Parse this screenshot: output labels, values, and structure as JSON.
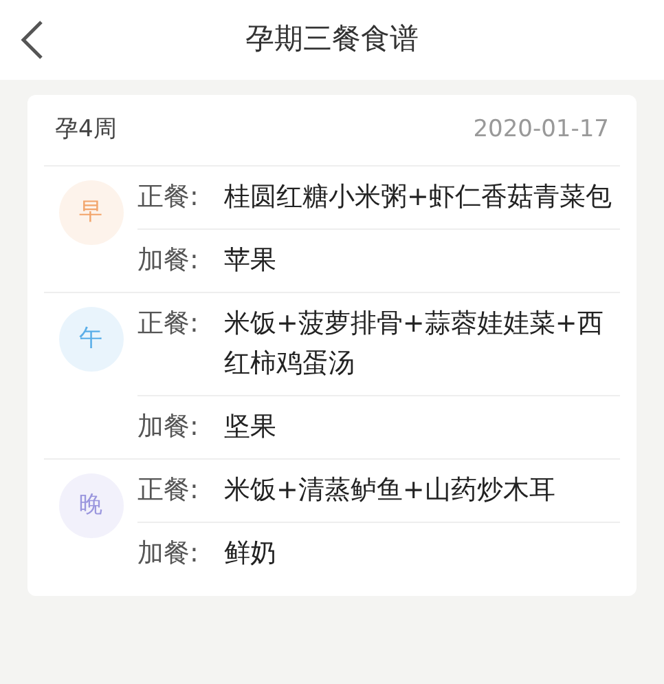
{
  "header": {
    "title": "孕期三餐食谱"
  },
  "card": {
    "week": "孕4周",
    "date": "2020-01-17",
    "meals": [
      {
        "badge": "早",
        "color": "#f2a56c",
        "items": [
          {
            "label": "正餐:",
            "text": "桂圆红糖小米粥+虾仁香菇青菜包"
          },
          {
            "label": "加餐:",
            "text": "苹果"
          }
        ]
      },
      {
        "badge": "午",
        "color": "#5aaee8",
        "items": [
          {
            "label": "正餐:",
            "text": "米饭+菠萝排骨+蒜蓉娃娃菜+西红柿鸡蛋汤"
          },
          {
            "label": "加餐:",
            "text": "坚果"
          }
        ]
      },
      {
        "badge": "晚",
        "color": "#9a96de",
        "items": [
          {
            "label": "正餐:",
            "text": "米饭+清蒸鲈鱼+山药炒木耳"
          },
          {
            "label": "加餐:",
            "text": "鲜奶"
          }
        ]
      }
    ]
  }
}
